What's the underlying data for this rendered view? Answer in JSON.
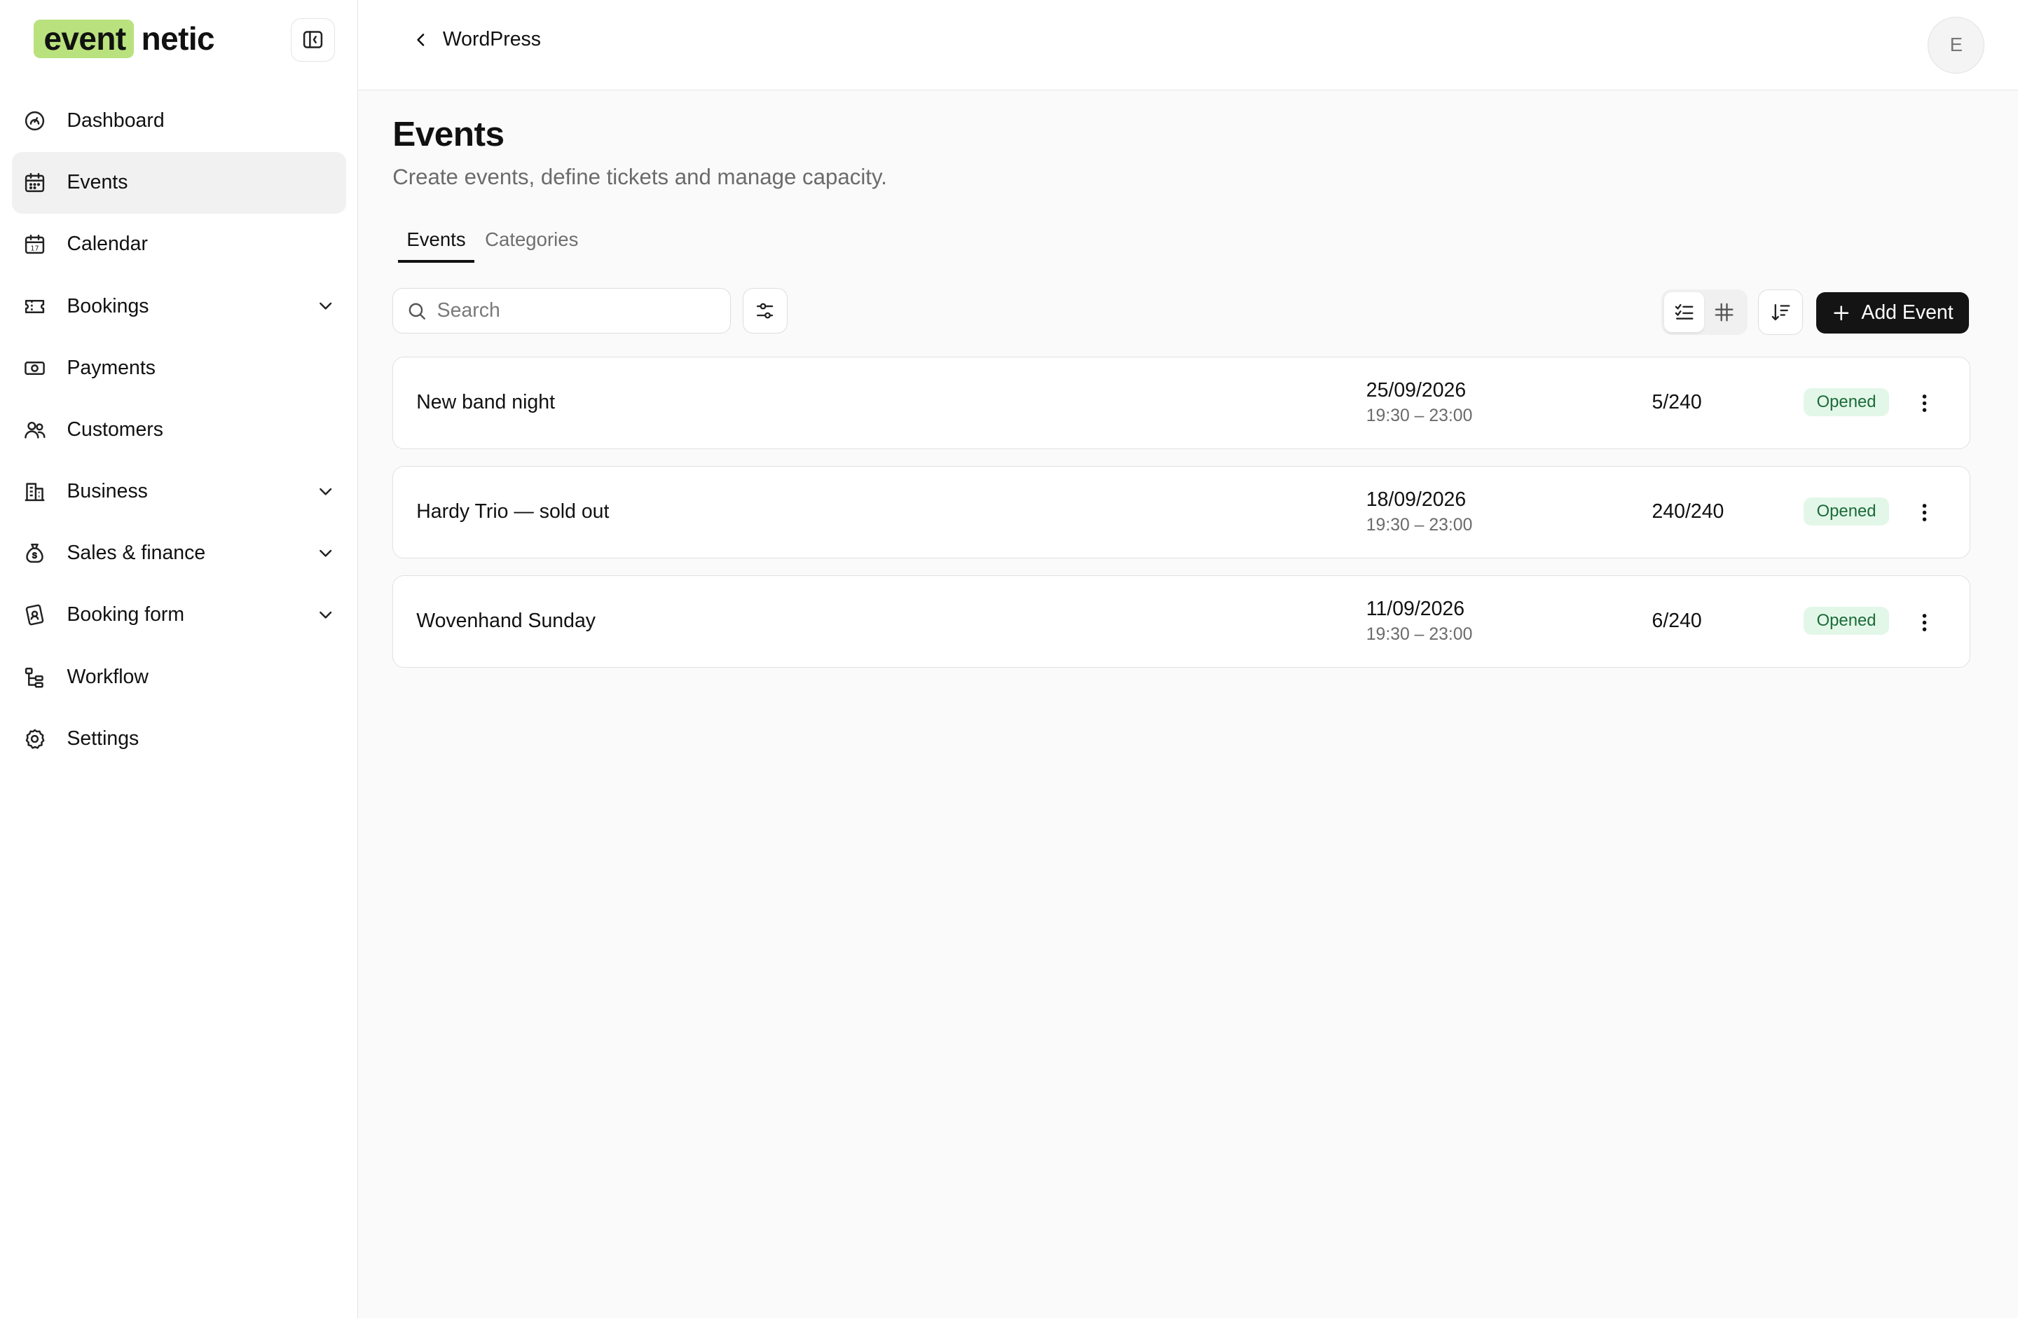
{
  "brand": {
    "logo_highlight": "event",
    "logo_rest": "netic",
    "accent": "#b9e27e"
  },
  "sidebar": {
    "items": [
      {
        "label": "Dashboard",
        "icon": "dashboard-icon",
        "active": false,
        "expandable": false
      },
      {
        "label": "Events",
        "icon": "calendar-grid-icon",
        "active": true,
        "expandable": false
      },
      {
        "label": "Calendar",
        "icon": "calendar-icon",
        "active": false,
        "expandable": false
      },
      {
        "label": "Bookings",
        "icon": "ticket-icon",
        "active": false,
        "expandable": true
      },
      {
        "label": "Payments",
        "icon": "money-icon",
        "active": false,
        "expandable": false
      },
      {
        "label": "Customers",
        "icon": "users-icon",
        "active": false,
        "expandable": false
      },
      {
        "label": "Business",
        "icon": "building-icon",
        "active": false,
        "expandable": true
      },
      {
        "label": "Sales & finance",
        "icon": "money-bag-icon",
        "active": false,
        "expandable": true
      },
      {
        "label": "Booking form",
        "icon": "form-icon",
        "active": false,
        "expandable": true
      },
      {
        "label": "Workflow",
        "icon": "workflow-icon",
        "active": false,
        "expandable": false
      },
      {
        "label": "Settings",
        "icon": "gear-icon",
        "active": false,
        "expandable": false
      }
    ]
  },
  "topbar": {
    "back_label": "WordPress",
    "avatar_initial": "E"
  },
  "main": {
    "title": "Events",
    "subtitle": "Create events, define tickets and manage capacity.",
    "tabs": [
      {
        "label": "Events",
        "active": true
      },
      {
        "label": "Categories",
        "active": false
      }
    ],
    "search": {
      "placeholder": "Search",
      "value": ""
    },
    "add_label": "Add Event",
    "events": [
      {
        "name": "New band night",
        "date": "25/09/2026",
        "time": "19:30 – 23:00",
        "capacity": "5/240",
        "status": "Opened"
      },
      {
        "name": "Hardy Trio — sold out",
        "date": "18/09/2026",
        "time": "19:30 – 23:00",
        "capacity": "240/240",
        "status": "Opened"
      },
      {
        "name": "Wovenhand Sunday",
        "date": "11/09/2026",
        "time": "19:30 – 23:00",
        "capacity": "6/240",
        "status": "Opened"
      }
    ]
  }
}
